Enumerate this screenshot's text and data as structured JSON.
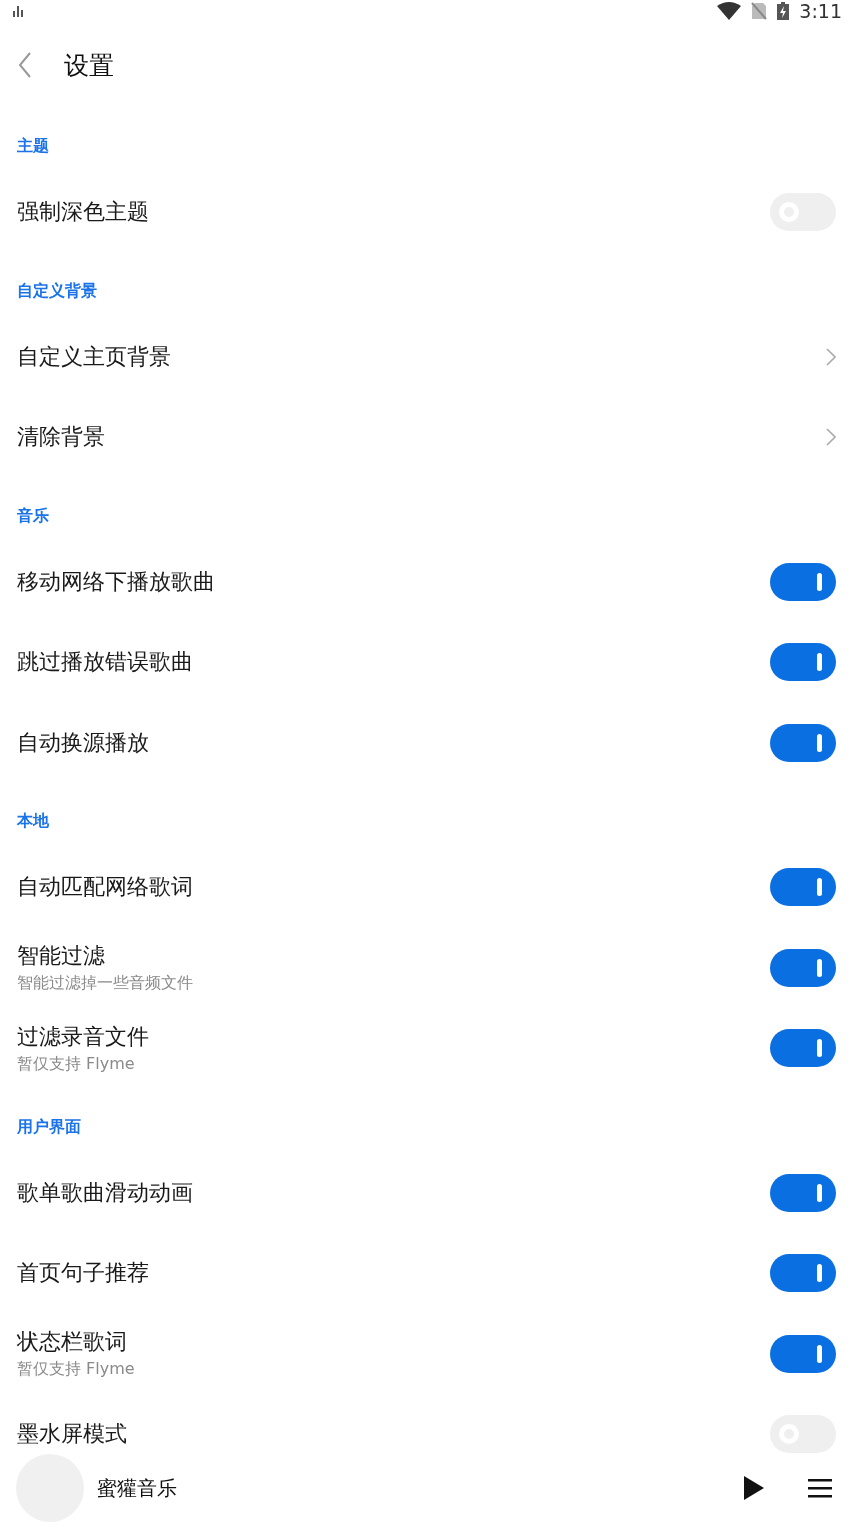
{
  "status_bar": {
    "time": "3:11"
  },
  "header": {
    "title": "设置"
  },
  "sections": [
    {
      "title": "主题",
      "items": [
        {
          "kind": "toggle",
          "label": "强制深色主题",
          "on": false
        }
      ]
    },
    {
      "title": "自定义背景",
      "items": [
        {
          "kind": "link",
          "label": "自定义主页背景"
        },
        {
          "kind": "link",
          "label": "清除背景"
        }
      ]
    },
    {
      "title": "音乐",
      "items": [
        {
          "kind": "toggle",
          "label": "移动网络下播放歌曲",
          "on": true
        },
        {
          "kind": "toggle",
          "label": "跳过播放错误歌曲",
          "on": true
        },
        {
          "kind": "toggle",
          "label": "自动换源播放",
          "on": true
        }
      ]
    },
    {
      "title": "本地",
      "items": [
        {
          "kind": "toggle",
          "label": "自动匹配网络歌词",
          "on": true
        },
        {
          "kind": "toggle",
          "label": "智能过滤",
          "subtitle": "智能过滤掉一些音频文件",
          "on": true
        },
        {
          "kind": "toggle",
          "label": "过滤录音文件",
          "subtitle": "暂仅支持 Flyme",
          "on": true
        }
      ]
    },
    {
      "title": "用户界面",
      "items": [
        {
          "kind": "toggle",
          "label": "歌单歌曲滑动动画",
          "on": true
        },
        {
          "kind": "toggle",
          "label": "首页句子推荐",
          "on": true
        },
        {
          "kind": "toggle",
          "label": "状态栏歌词",
          "subtitle": "暂仅支持 Flyme",
          "on": true
        },
        {
          "kind": "toggle",
          "label": "墨水屏模式",
          "on": false
        }
      ]
    }
  ],
  "mini_player": {
    "title": "蜜獾音乐"
  }
}
